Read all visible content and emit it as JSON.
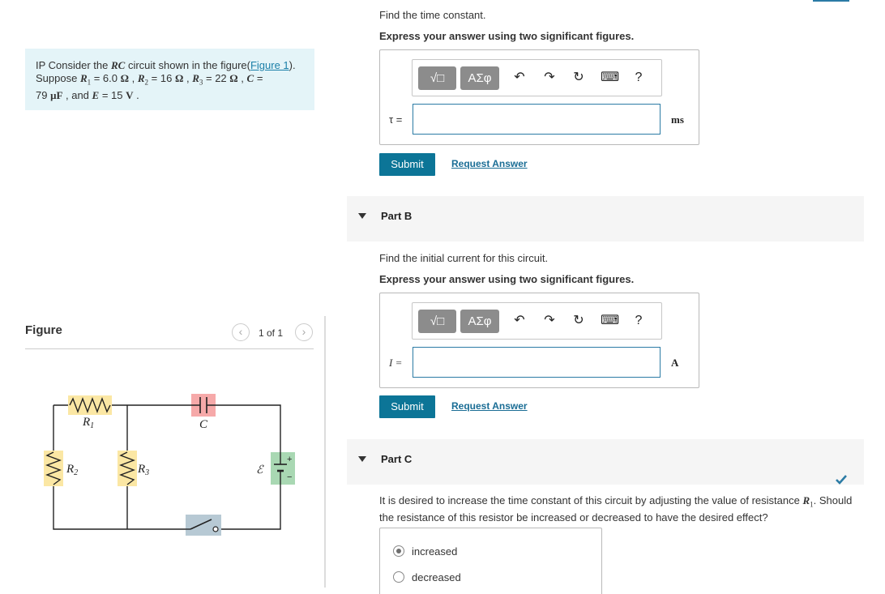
{
  "problem": {
    "prefix": "IP Consider the ",
    "rc": "RC",
    "mid": " circuit shown in the figure(",
    "figure_link": "Figure 1",
    "after_link": ").",
    "line2": [
      {
        "t": "Suppose "
      },
      {
        "t": "R",
        "i": true
      },
      {
        "t": "1",
        "sub": true
      },
      {
        "t": " = 6.0 "
      },
      {
        "t": "Ω",
        "b": true
      },
      {
        "t": " , "
      },
      {
        "t": "R",
        "i": true
      },
      {
        "t": "2",
        "sub": true
      },
      {
        "t": " = 16 "
      },
      {
        "t": "Ω",
        "b": true
      },
      {
        "t": " , "
      },
      {
        "t": "R",
        "i": true
      },
      {
        "t": "3",
        "sub": true
      },
      {
        "t": " = 22 "
      },
      {
        "t": "Ω",
        "b": true
      },
      {
        "t": " , "
      },
      {
        "t": "C",
        "i": true
      },
      {
        "t": " ="
      }
    ],
    "line3": [
      {
        "t": "79 "
      },
      {
        "t": "μF",
        "b": true
      },
      {
        "t": " , and "
      },
      {
        "t": "E",
        "i": true
      },
      {
        "t": " = 15 "
      },
      {
        "t": "V",
        "b": true
      },
      {
        "t": " ."
      }
    ]
  },
  "figure": {
    "label": "Figure",
    "pager": "1 of 1",
    "labels": {
      "r1": "R",
      "r1_sub": "1",
      "r2": "R",
      "r2_sub": "2",
      "r3": "R",
      "r3_sub": "3",
      "c": "C",
      "emf": "ℰ",
      "plus": "+",
      "minus": "−"
    },
    "colors": {
      "resistor_bg": "#fbe7a4",
      "cap_bg": "#f6a9a9",
      "battery_bg": "#a9d8b3",
      "switch_bg": "#b7c9d4"
    }
  },
  "part_a": {
    "question": "Find the time constant.",
    "instruction": "Express your answer using two significant figures.",
    "toolbar": {
      "templates": "√□",
      "greek": "ΑΣφ",
      "help": "?"
    },
    "variable": "τ =",
    "unit": "ms",
    "submit": "Submit",
    "request": "Request Answer"
  },
  "part_b": {
    "title": "Part B",
    "question": "Find the initial current for this circuit.",
    "instruction": "Express your answer using two significant figures.",
    "toolbar": {
      "templates": "√□",
      "greek": "ΑΣφ",
      "help": "?"
    },
    "variable": "I =",
    "unit": "A",
    "submit": "Submit",
    "request": "Request Answer"
  },
  "part_c": {
    "title": "Part C",
    "question_start": "It is desired to increase the time constant of this circuit by adjusting the value of resistance ",
    "question_var": "R",
    "question_sub": "1",
    "question_end": ". Should",
    "question_line2": "the resistance of this resistor be increased or decreased to have the desired effect?",
    "options": [
      "increased",
      "decreased"
    ],
    "selected": "increased",
    "check_color": "#2b7ba5"
  }
}
